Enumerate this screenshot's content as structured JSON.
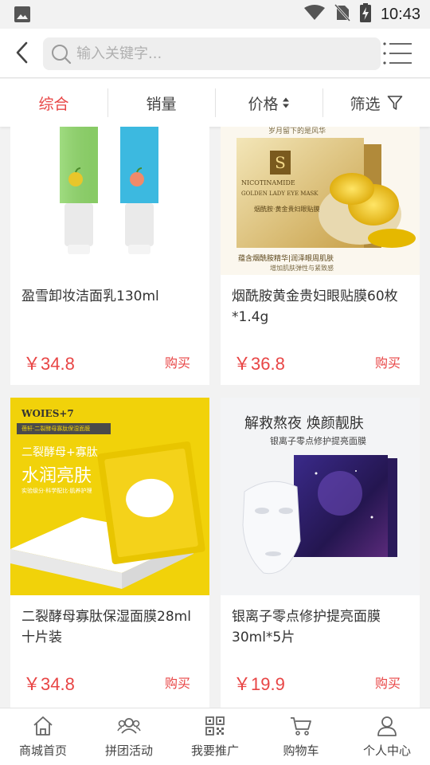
{
  "status_bar": {
    "time": "10:43",
    "icons": [
      "image-icon",
      "wifi-icon",
      "no-sim-icon",
      "battery-charging-icon"
    ]
  },
  "header": {
    "back_icon": "back-chevron-icon",
    "search_placeholder": "输入关键字...",
    "search_value": "",
    "menu_icon": "list-menu-icon"
  },
  "sort_bar": {
    "tabs": [
      {
        "label": "综合",
        "active": true
      },
      {
        "label": "销量",
        "active": false
      },
      {
        "label": "价格",
        "active": false,
        "icon": "sort-arrows-icon"
      },
      {
        "label": "筛选",
        "active": false,
        "icon": "filter-icon"
      }
    ]
  },
  "products": [
    {
      "name": "盈雪卸妆洁面乳130ml",
      "price": "￥34.8",
      "buy_label": "购买"
    },
    {
      "name": "烟酰胺黄金贵妇眼贴膜60枚*1.4g",
      "price": "￥36.8",
      "buy_label": "购买",
      "image_text": {
        "top": "岁月留下的是风华",
        "brand_line1": "NICOTINAMIDE",
        "brand_line2": "GOLDEN LADY EYE MASK",
        "cn1": "烟酰胺·黄金贵妇眼贴膜",
        "bottom": "蕴含烟酰胺精华|润泽眼周肌肤",
        "bottom2": "增加肌肤弹性与紧致感"
      }
    },
    {
      "name": "二裂酵母寡肽保湿面膜28ml十片装",
      "price": "￥34.8",
      "buy_label": "购买",
      "image_text": {
        "brand": "WOIES+7",
        "tag": "蓓轩·二裂酵母寡肽保湿面膜",
        "line1": "二裂酵母+寡肽",
        "line2": "水润亮肤",
        "line3": "实验级分·科学配比·肌养护理"
      }
    },
    {
      "name": "银离子零点修护提亮面膜30ml*5片",
      "price": "￥19.9",
      "buy_label": "购买",
      "image_text": {
        "headline": "解救熬夜 焕颜靓肤",
        "sub": "银离子零点修护提亮面膜"
      }
    }
  ],
  "bottom_nav": [
    {
      "label": "商城首页",
      "icon": "home-icon"
    },
    {
      "label": "拼团活动",
      "icon": "group-icon"
    },
    {
      "label": "我要推广",
      "icon": "qrcode-icon"
    },
    {
      "label": "购物车",
      "icon": "cart-icon"
    },
    {
      "label": "个人中心",
      "icon": "user-icon"
    }
  ],
  "colors": {
    "accent": "#e84545",
    "background": "#f2f2f2",
    "card": "#ffffff",
    "text": "#333333"
  }
}
